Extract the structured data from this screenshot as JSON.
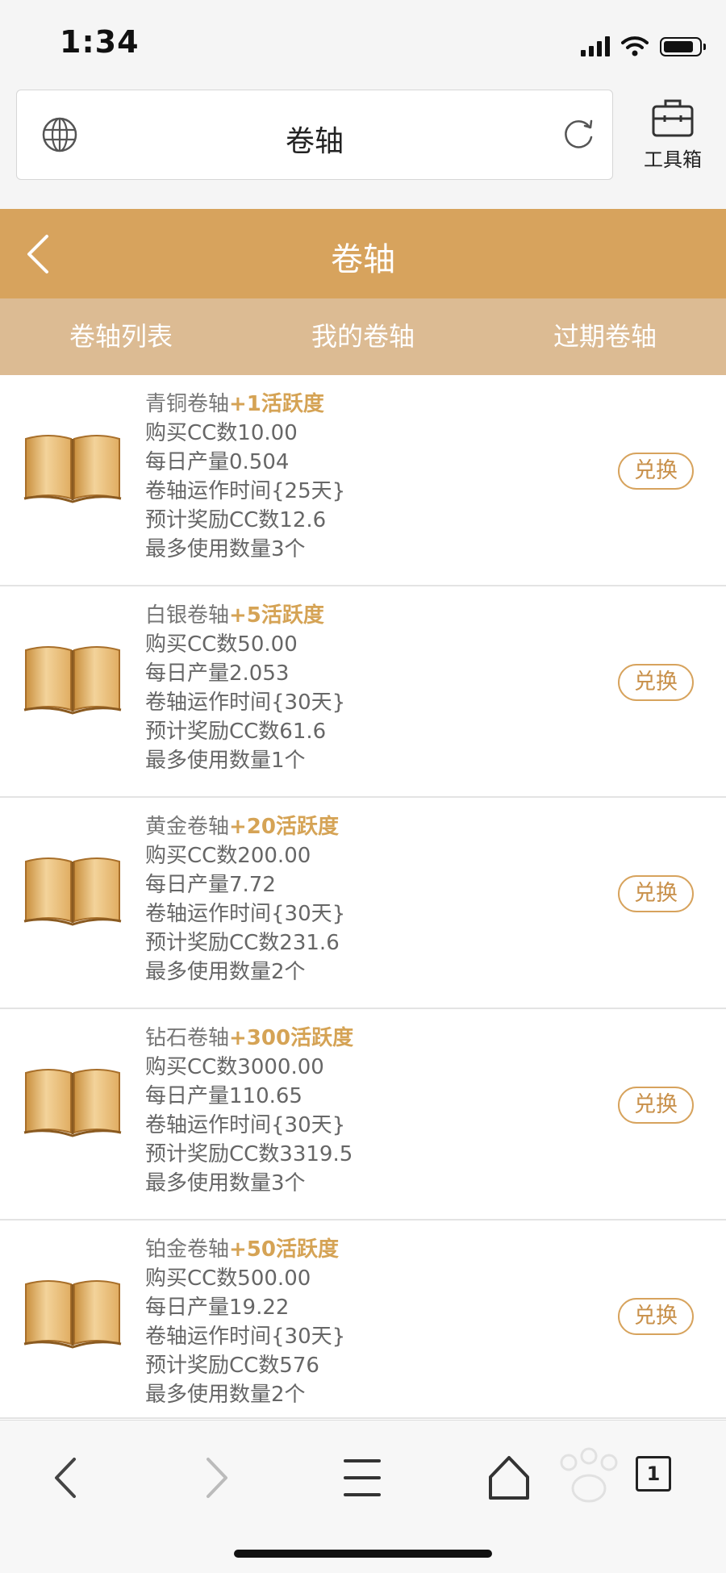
{
  "status_bar": {
    "time": "1:34",
    "icons": [
      "signal-icon",
      "wifi-icon",
      "battery-icon"
    ],
    "battery_level": 0.8
  },
  "browser": {
    "url_title": "卷轴",
    "toolbox_label": "工具箱",
    "icons": [
      "globe-icon",
      "reload-icon",
      "toolbox-icon"
    ]
  },
  "header": {
    "title": "卷轴",
    "back_icon": "chevron-left-icon"
  },
  "tabs": [
    {
      "label": "卷轴列表"
    },
    {
      "label": "我的卷轴"
    },
    {
      "label": "过期卷轴"
    }
  ],
  "scrolls": [
    {
      "name": "青铜卷轴",
      "bonus": "+1活跃度",
      "purchase": "购买CC数10.00",
      "daily": "每日产量0.504",
      "runtime": "卷轴运作时间{25天}",
      "reward": "预计奖励CC数12.6",
      "max_use": "最多使用数量3个",
      "button": "兑换"
    },
    {
      "name": "白银卷轴",
      "bonus": "+5活跃度",
      "purchase": "购买CC数50.00",
      "daily": "每日产量2.053",
      "runtime": "卷轴运作时间{30天}",
      "reward": "预计奖励CC数61.6",
      "max_use": "最多使用数量1个",
      "button": "兑换"
    },
    {
      "name": "黄金卷轴",
      "bonus": "+20活跃度",
      "purchase": "购买CC数200.00",
      "daily": "每日产量7.72",
      "runtime": "卷轴运作时间{30天}",
      "reward": "预计奖励CC数231.6",
      "max_use": "最多使用数量2个",
      "button": "兑换"
    },
    {
      "name": "钻石卷轴",
      "bonus": "+300活跃度",
      "purchase": "购买CC数3000.00",
      "daily": "每日产量110.65",
      "runtime": "卷轴运作时间{30天}",
      "reward": "预计奖励CC数3319.5",
      "max_use": "最多使用数量3个",
      "button": "兑换"
    },
    {
      "name": "铂金卷轴",
      "bonus": "+50活跃度",
      "purchase": "购买CC数500.00",
      "daily": "每日产量19.22",
      "runtime": "卷轴运作时间{30天}",
      "reward": "预计奖励CC数576",
      "max_use": "最多使用数量2个",
      "button": "兑换"
    }
  ],
  "bottom_bar": {
    "tab_count": "1",
    "icons": [
      "back-icon",
      "forward-icon",
      "menu-icon",
      "home-icon",
      "tabs-icon"
    ]
  },
  "colors": {
    "accent": "#d7a35d",
    "tab_bar": "#dcbb93",
    "bonus_text": "#d5a355"
  }
}
